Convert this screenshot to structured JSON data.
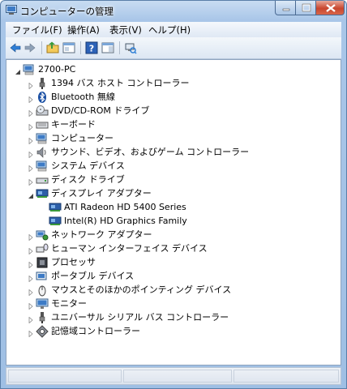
{
  "window": {
    "title": "コンピューターの管理"
  },
  "menu": [
    "ファイル(F)",
    "操作(A)",
    "表示(V)",
    "ヘルプ(H)"
  ],
  "toolbar": {
    "buttons": [
      "back-arrow-icon",
      "forward-arrow-icon",
      "up-folder-icon",
      "properties-panel-icon",
      "help-icon",
      "action-pane-icon",
      "scan-hardware-icon"
    ]
  },
  "tree": {
    "root": {
      "label": "2700-PC",
      "icon": "computer-icon",
      "expanded": true
    },
    "items": [
      {
        "label": "1394 バス ホスト コントローラー",
        "icon": "1394-connector-icon",
        "expanded": false
      },
      {
        "label": "Bluetooth 無線",
        "icon": "bluetooth-icon",
        "expanded": false
      },
      {
        "label": "DVD/CD-ROM ドライブ",
        "icon": "optical-drive-icon",
        "expanded": false
      },
      {
        "label": "キーボード",
        "icon": "keyboard-icon",
        "expanded": false
      },
      {
        "label": "コンピューター",
        "icon": "computer-icon",
        "expanded": false
      },
      {
        "label": "サウンド、ビデオ、およびゲーム コントローラー",
        "icon": "speaker-icon",
        "expanded": false
      },
      {
        "label": "システム デバイス",
        "icon": "system-device-icon",
        "expanded": false
      },
      {
        "label": "ディスク ドライブ",
        "icon": "disk-drive-icon",
        "expanded": false
      },
      {
        "label": "ディスプレイ アダプター",
        "icon": "display-adapter-icon",
        "expanded": true,
        "children": [
          {
            "label": "ATI Radeon HD 5400 Series",
            "icon": "display-adapter-icon"
          },
          {
            "label": "Intel(R) HD Graphics Family",
            "icon": "display-adapter-icon"
          }
        ]
      },
      {
        "label": "ネットワーク アダプター",
        "icon": "network-adapter-icon",
        "expanded": false
      },
      {
        "label": "ヒューマン インターフェイス デバイス",
        "icon": "hid-icon",
        "expanded": false
      },
      {
        "label": "プロセッサ",
        "icon": "processor-icon",
        "expanded": false
      },
      {
        "label": "ポータブル デバイス",
        "icon": "portable-device-icon",
        "expanded": false
      },
      {
        "label": "マウスとそのほかのポインティング デバイス",
        "icon": "mouse-icon",
        "expanded": false
      },
      {
        "label": "モニター",
        "icon": "monitor-icon",
        "expanded": false
      },
      {
        "label": "ユニバーサル シリアル バス コントローラー",
        "icon": "usb-icon",
        "expanded": false
      },
      {
        "label": "記憶域コントローラー",
        "icon": "storage-controller-icon",
        "expanded": false
      }
    ]
  },
  "colors": {
    "titlebar": "#a9c6e8",
    "close_button": "#c8462e",
    "selection": "#3399ff"
  }
}
